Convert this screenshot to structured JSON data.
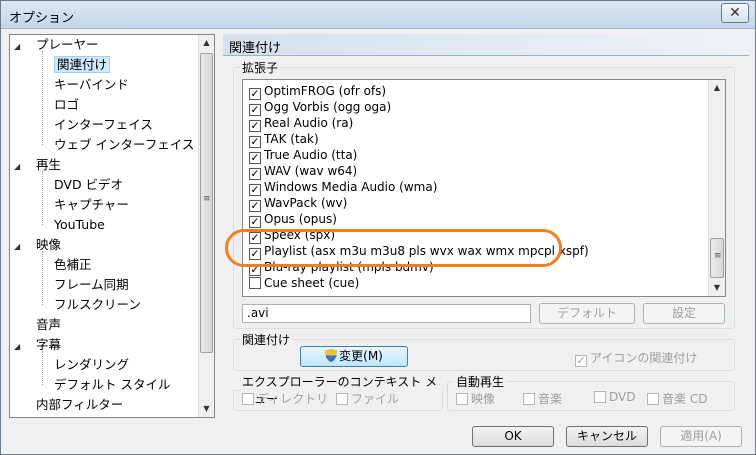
{
  "window": {
    "title": "オプション",
    "close_glyph": "✕"
  },
  "tree": {
    "items": [
      {
        "label": "プレーヤー",
        "expander": "◢",
        "level": 0
      },
      {
        "label": "関連付け",
        "level": 1,
        "selected": true
      },
      {
        "label": "キーバインド",
        "level": 1
      },
      {
        "label": "ロゴ",
        "level": 1
      },
      {
        "label": "インターフェイス",
        "level": 1
      },
      {
        "label": "ウェブ インターフェイス",
        "level": 1
      },
      {
        "label": "再生",
        "expander": "◢",
        "level": 0
      },
      {
        "label": "DVD ビデオ",
        "level": 1
      },
      {
        "label": "キャプチャー",
        "level": 1
      },
      {
        "label": "YouTube",
        "level": 1
      },
      {
        "label": "映像",
        "expander": "◢",
        "level": 0
      },
      {
        "label": "色補正",
        "level": 1
      },
      {
        "label": "フレーム同期",
        "level": 1
      },
      {
        "label": "フルスクリーン",
        "level": 1
      },
      {
        "label": "音声",
        "level": 0
      },
      {
        "label": "字幕",
        "expander": "◢",
        "level": 0
      },
      {
        "label": "レンダリング",
        "level": 1
      },
      {
        "label": "デフォルト スタイル",
        "level": 1
      },
      {
        "label": "内部フィルター",
        "level": 0
      }
    ]
  },
  "page": {
    "header": "関連付け",
    "extensions_group": "拡張子",
    "extensions": [
      {
        "label": "OptimFROG (ofr ofs)",
        "checked": true
      },
      {
        "label": "Ogg Vorbis (ogg oga)",
        "checked": true
      },
      {
        "label": "Real Audio (ra)",
        "checked": true
      },
      {
        "label": "TAK (tak)",
        "checked": true
      },
      {
        "label": "True Audio (tta)",
        "checked": true
      },
      {
        "label": "WAV (wav w64)",
        "checked": true
      },
      {
        "label": "Windows Media Audio (wma)",
        "checked": true
      },
      {
        "label": "WavPack (wv)",
        "checked": true
      },
      {
        "label": "Opus (opus)",
        "checked": true
      },
      {
        "label": "Speex (spx)",
        "checked": true
      },
      {
        "label": "Playlist (asx m3u m3u8 pls wvx wax wmx mpcpl xspf)",
        "checked": true
      },
      {
        "label": "Blu-ray playlist (mpls bdmv)",
        "checked": true
      },
      {
        "label": "Cue sheet (cue)",
        "checked": false
      }
    ],
    "ext_input_value": ".avi",
    "default_button": "デフォルト",
    "settings_button": "設定",
    "association_group": "関連付け",
    "change_button": "変更(M)",
    "icon_assoc_label": "アイコンの関連付け",
    "icon_assoc_checked": true,
    "explorer_group": "エクスプローラーのコンテキスト メニュー",
    "directory_label": "ディレクトリ",
    "file_label": "ファイル",
    "autoplay_group": "自動再生",
    "video_label": "映像",
    "music_label": "音楽",
    "dvd_label": "DVD",
    "audiocd_label": "音楽 CD"
  },
  "footer": {
    "ok": "OK",
    "cancel": "キャンセル",
    "apply": "適用(A)"
  },
  "colors": {
    "highlight": "#f07f1f"
  }
}
